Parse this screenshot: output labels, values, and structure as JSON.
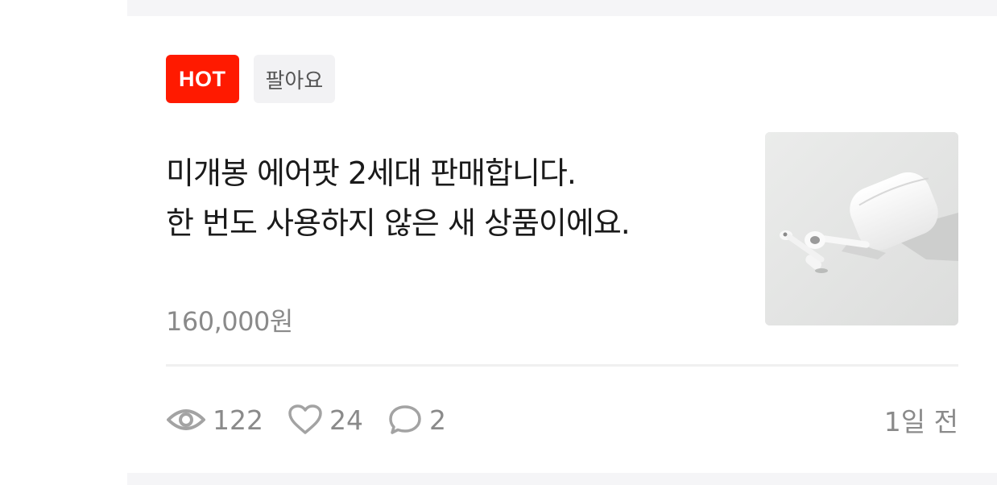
{
  "badges": {
    "hot": "HOT",
    "category": "팔아요"
  },
  "post": {
    "title_line1": "미개봉 에어팟 2세대 판매합니다.",
    "title_line2": "한 번도 사용하지 않은 새 상품이에요.",
    "price": "160,000원",
    "thumbnail": "airpods-product-photo"
  },
  "stats": {
    "views": "122",
    "likes": "24",
    "comments": "2",
    "posted_ago": "1일 전"
  },
  "colors": {
    "hot_badge": "#ff1a00",
    "category_badge_bg": "#f2f2f4",
    "muted_text": "#8a8a8a",
    "title_text": "#1a1a1a",
    "band_bg": "#f5f5f7"
  },
  "icons": [
    "eye-icon",
    "heart-icon",
    "speech-bubble-icon"
  ]
}
